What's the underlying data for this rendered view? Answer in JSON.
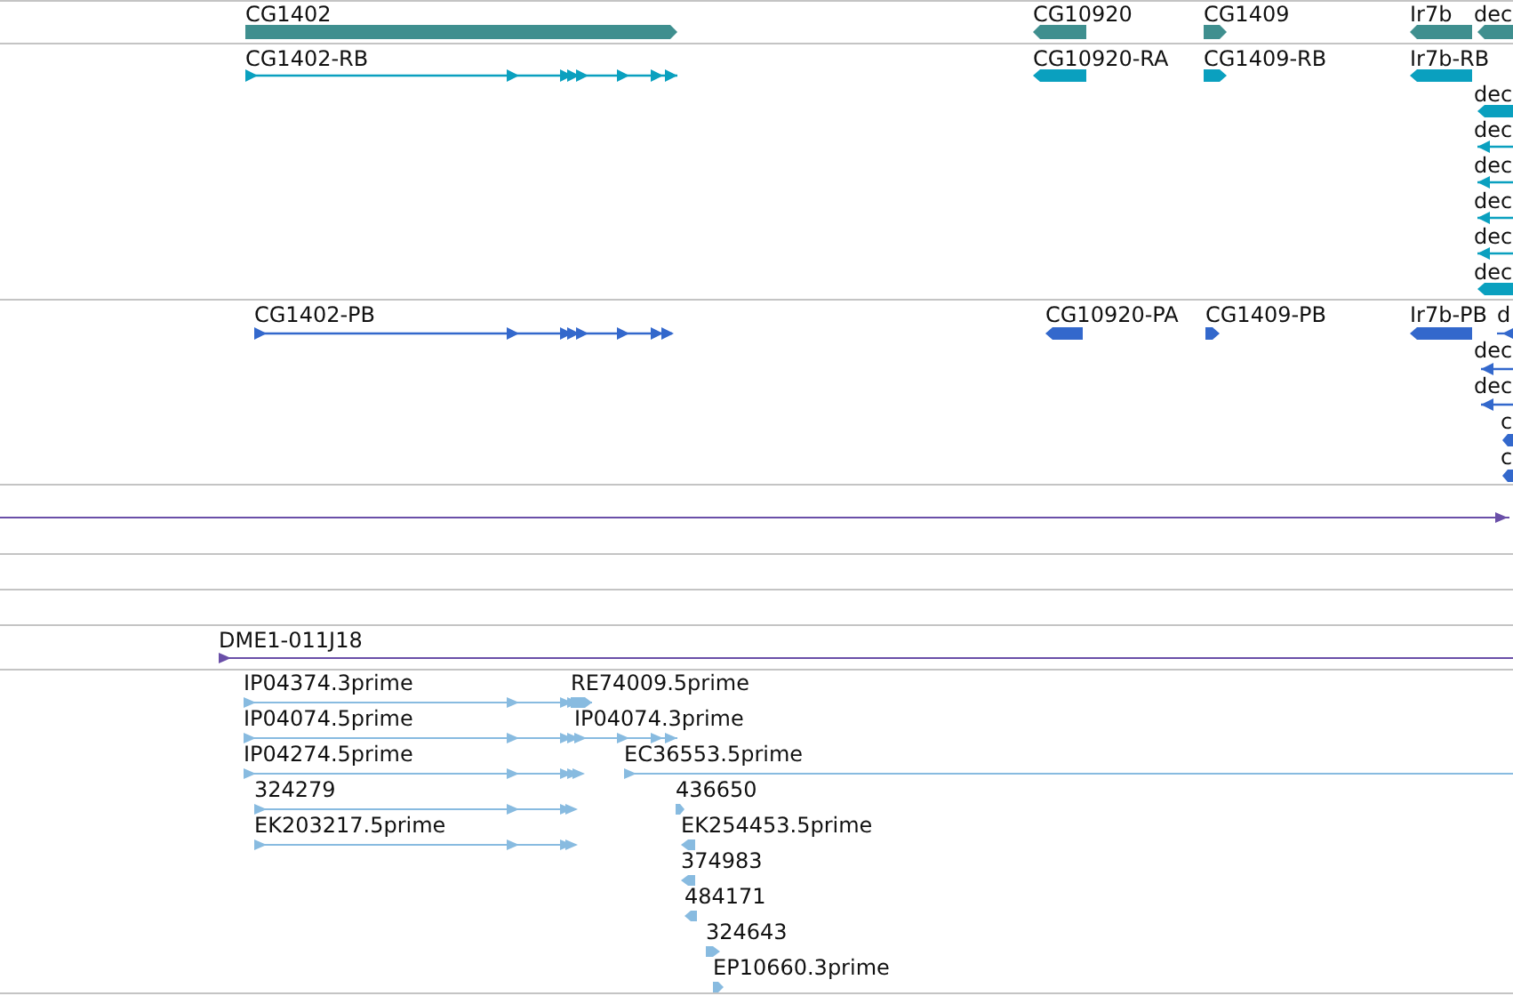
{
  "tracks": [
    {
      "kind": "gene",
      "color": "#3f8f8f",
      "features": [
        {
          "label": "CG1402",
          "reverse": false
        },
        {
          "label": "CG10920",
          "reverse": true
        },
        {
          "label": "CG1409",
          "reverse": false
        },
        {
          "label": "Ir7b",
          "reverse": true
        },
        {
          "label": "dec",
          "reverse": true
        }
      ]
    },
    {
      "kind": "transcript",
      "color": "#0aa0bf",
      "features": [
        {
          "label": "CG1402-RB",
          "reverse": false
        },
        {
          "label": "CG10920-RA",
          "reverse": true
        },
        {
          "label": "CG1409-RB",
          "reverse": false
        },
        {
          "label": "Ir7b-RB",
          "reverse": true
        },
        {
          "label": "dec",
          "reverse": true
        },
        {
          "label": "dec",
          "reverse": true
        },
        {
          "label": "dec",
          "reverse": true
        },
        {
          "label": "dec",
          "reverse": true
        },
        {
          "label": "dec",
          "reverse": true
        },
        {
          "label": "dec",
          "reverse": true
        }
      ]
    },
    {
      "kind": "protein",
      "color": "#3368cc",
      "features": [
        {
          "label": "CG1402-PB",
          "reverse": false
        },
        {
          "label": "CG10920-PA",
          "reverse": true
        },
        {
          "label": "CG1409-PB",
          "reverse": false
        },
        {
          "label": "Ir7b-PB",
          "reverse": true
        },
        {
          "label": "d",
          "reverse": true
        },
        {
          "label": "dec",
          "reverse": true
        },
        {
          "label": "dec",
          "reverse": true
        },
        {
          "label": "c",
          "reverse": true
        },
        {
          "label": "c",
          "reverse": true
        }
      ]
    },
    {
      "kind": "feature",
      "color": "#6a4fa8",
      "features": [
        {
          "reverse": false
        }
      ]
    },
    {
      "kind": "empty"
    },
    {
      "kind": "empty"
    },
    {
      "kind": "clone",
      "color": "#6a4fa8",
      "features": [
        {
          "label": "DME1-011J18",
          "reverse": false
        }
      ]
    },
    {
      "kind": "est",
      "color": "#88bbe0",
      "features": [
        {
          "label": "IP04374.3prime",
          "reverse": false
        },
        {
          "label": "RE74009.5prime",
          "reverse": false
        },
        {
          "label": "IP04074.5prime",
          "reverse": false
        },
        {
          "label": "IP04074.3prime",
          "reverse": false
        },
        {
          "label": "IP04274.5prime",
          "reverse": false
        },
        {
          "label": "EC36553.5prime",
          "reverse": false
        },
        {
          "label": "324279",
          "reverse": false
        },
        {
          "label": "436650",
          "reverse": false
        },
        {
          "label": "EK203217.5prime",
          "reverse": false
        },
        {
          "label": "EK254453.5prime",
          "reverse": true
        },
        {
          "label": "374983",
          "reverse": true
        },
        {
          "label": "484171",
          "reverse": true
        },
        {
          "label": "324643",
          "reverse": false
        },
        {
          "label": "EP10660.3prime",
          "reverse": false
        }
      ]
    }
  ]
}
